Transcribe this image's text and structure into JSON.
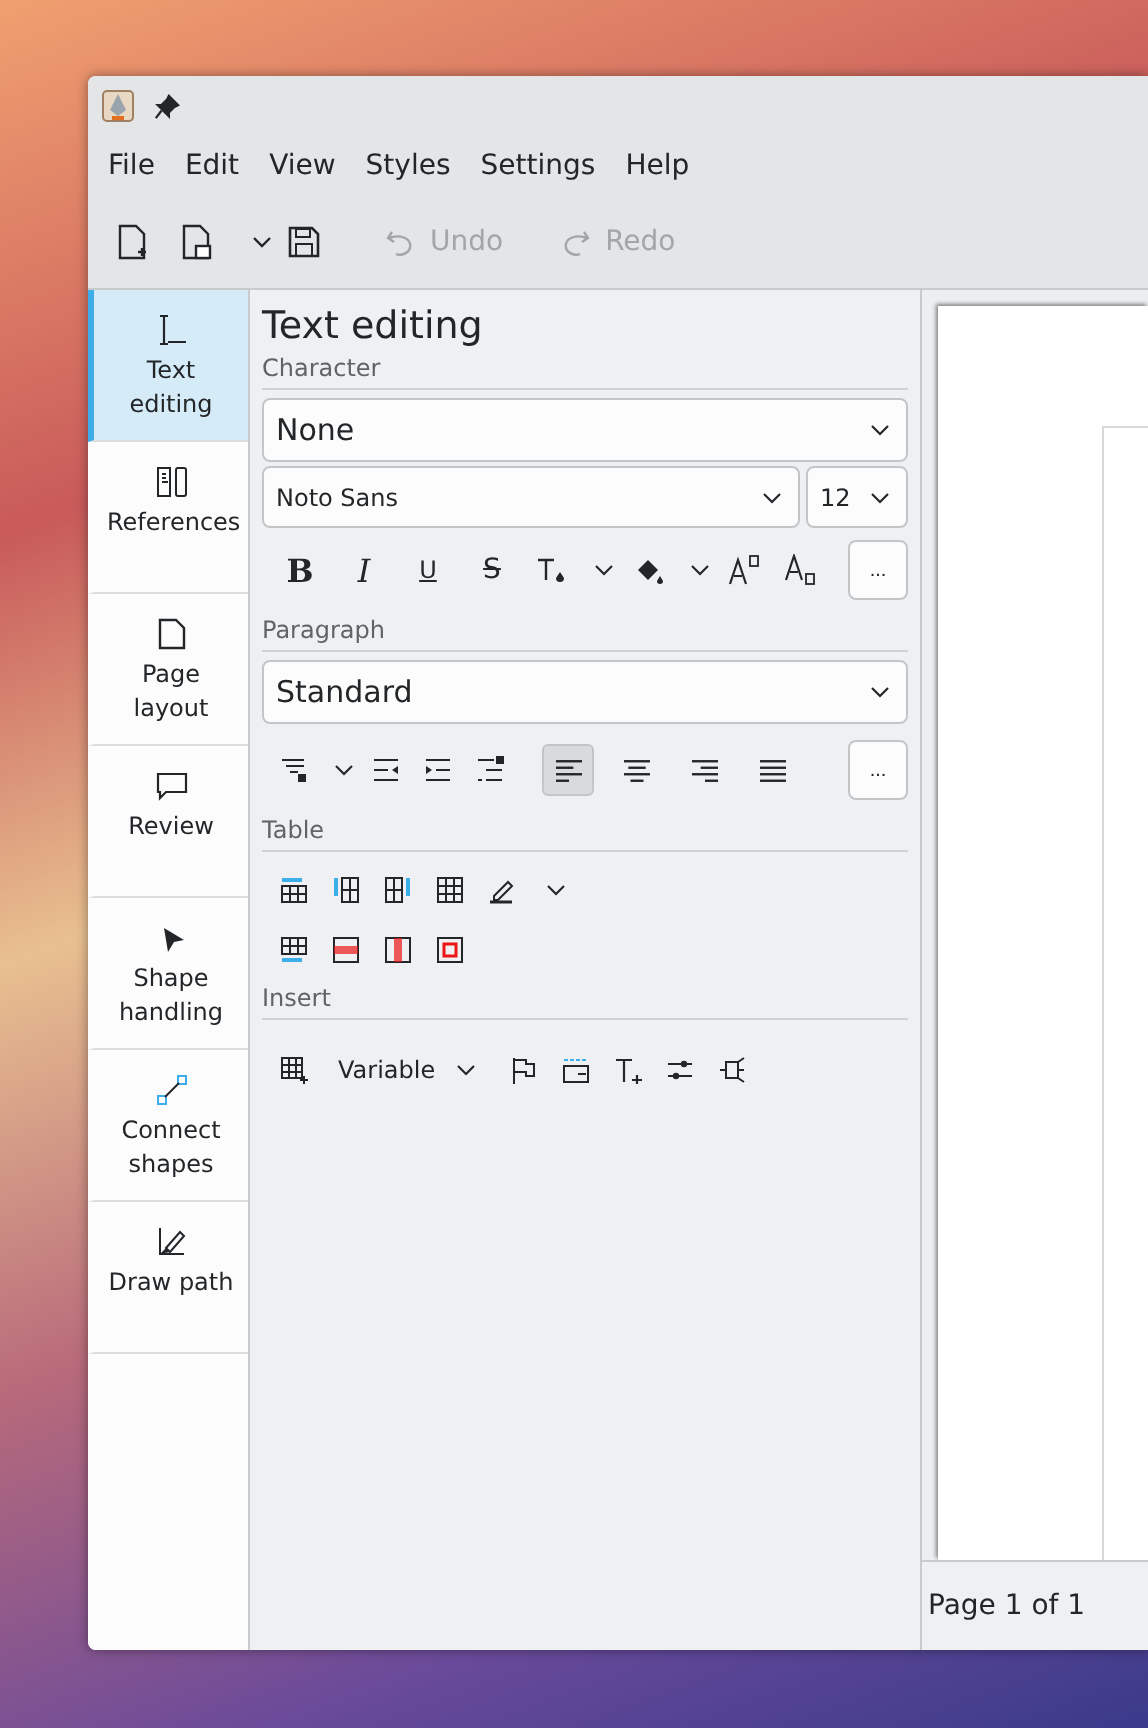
{
  "menu": [
    "File",
    "Edit",
    "View",
    "Styles",
    "Settings",
    "Help"
  ],
  "toolbar": {
    "undo": {
      "label": "Undo",
      "disabled": true
    },
    "redo": {
      "label": "Redo",
      "disabled": true
    }
  },
  "sidebar": [
    {
      "kind": "text",
      "label": "Text editing",
      "selected": true
    },
    {
      "kind": "references",
      "label": "References",
      "selected": false
    },
    {
      "kind": "page",
      "label": "Page layout",
      "selected": false
    },
    {
      "kind": "review",
      "label": "Review",
      "selected": false
    },
    {
      "kind": "shape",
      "label": "Shape handling",
      "selected": false
    },
    {
      "kind": "connect",
      "label": "Connect shapes",
      "selected": false
    },
    {
      "kind": "path",
      "label": "Draw path",
      "selected": false
    }
  ],
  "panel": {
    "title": "Text editing",
    "character": {
      "heading": "Character",
      "style": "None",
      "font": "Noto Sans",
      "size": "12",
      "formats": [
        {
          "kind": "bold",
          "label": "B"
        },
        {
          "kind": "italic",
          "label": "I"
        },
        {
          "kind": "underline",
          "label": "U"
        },
        {
          "kind": "strike",
          "label": "S"
        }
      ],
      "more": "..."
    },
    "paragraph": {
      "heading": "Paragraph",
      "style": "Standard",
      "alignments": [
        {
          "kind": "left",
          "selected": true
        },
        {
          "kind": "center",
          "selected": false
        },
        {
          "kind": "right",
          "selected": false
        },
        {
          "kind": "justify",
          "selected": false
        }
      ],
      "more": "..."
    },
    "table": {
      "heading": "Table"
    },
    "insert": {
      "heading": "Insert",
      "variable": "Variable"
    }
  },
  "status_bar": {
    "page": "Page 1 of 1"
  }
}
